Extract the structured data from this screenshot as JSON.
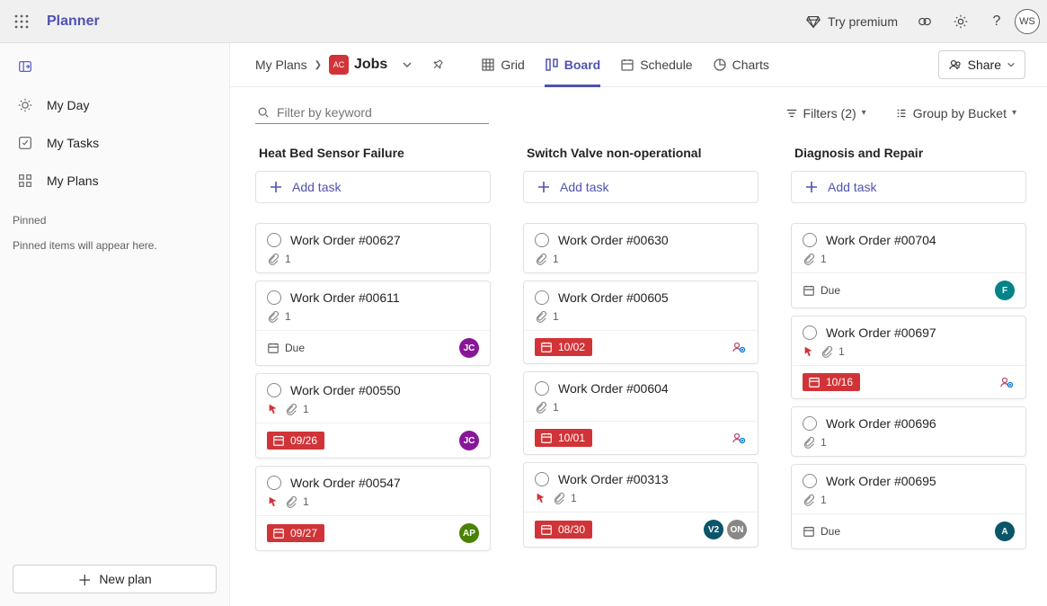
{
  "titlebar": {
    "brand": "Planner",
    "try_premium": "Try premium",
    "avatar_initials": "WS"
  },
  "sidebar": {
    "my_day": "My Day",
    "my_tasks": "My Tasks",
    "my_plans": "My Plans",
    "pinned_header": "Pinned",
    "pinned_empty": "Pinned items will appear here.",
    "new_plan": "New plan"
  },
  "plan_header": {
    "breadcrumb_root": "My Plans",
    "plan_badge": "AC",
    "plan_name": "Jobs",
    "views": {
      "grid": "Grid",
      "board": "Board",
      "schedule": "Schedule",
      "charts": "Charts"
    },
    "share": "Share"
  },
  "toolbar": {
    "filter_placeholder": "Filter by keyword",
    "filters_label": "Filters (2)",
    "group_label": "Group by Bucket"
  },
  "buckets": [
    {
      "title": "Heat Bed Sensor Failure",
      "add_label": "Add task",
      "groups": [
        {
          "rows": [
            {
              "title": "Work Order #00627",
              "attach": "1"
            }
          ]
        },
        {
          "rows": [
            {
              "title": "Work Order #00611",
              "attach": "1"
            }
          ],
          "footer": {
            "type": "plain",
            "text": "Due",
            "avatars": [
              {
                "kind": "purple",
                "text": "JC"
              }
            ]
          }
        },
        {
          "rows": [
            {
              "title": "Work Order #00550",
              "urgent": true,
              "attach": "1"
            }
          ],
          "footer": {
            "type": "red",
            "text": "09/26",
            "avatars": [
              {
                "kind": "purple",
                "text": "JC"
              }
            ]
          }
        },
        {
          "rows": [
            {
              "title": "Work Order #00547",
              "urgent": true,
              "attach": "1"
            }
          ],
          "footer": {
            "type": "red",
            "text": "09/27",
            "avatars": [
              {
                "kind": "dgreen",
                "text": "AP"
              }
            ]
          }
        }
      ]
    },
    {
      "title": "Switch Valve non-operational",
      "add_label": "Add task",
      "groups": [
        {
          "rows": [
            {
              "title": "Work Order #00630",
              "attach": "1"
            }
          ]
        },
        {
          "rows": [
            {
              "title": "Work Order #00605",
              "attach": "1"
            }
          ],
          "footer": {
            "type": "red",
            "text": "10/02",
            "assign_icon": true
          }
        },
        {
          "rows": [
            {
              "title": "Work Order #00604",
              "attach": "1"
            }
          ],
          "footer": {
            "type": "red",
            "text": "10/01",
            "assign_icon": true
          }
        },
        {
          "rows": [
            {
              "title": "Work Order #00313",
              "urgent": true,
              "attach": "1"
            }
          ],
          "footer": {
            "type": "red",
            "text": "08/30",
            "avatars": [
              {
                "kind": "navy",
                "text": "V2"
              },
              {
                "kind": "gray",
                "text": "ON"
              }
            ]
          }
        }
      ]
    },
    {
      "title": "Diagnosis and Repair",
      "add_label": "Add task",
      "groups": [
        {
          "rows": [
            {
              "title": "Work Order #00704",
              "attach": "1"
            }
          ],
          "footer": {
            "type": "plain",
            "text": "Due",
            "avatars": [
              {
                "kind": "teal",
                "text": "F"
              }
            ]
          }
        },
        {
          "rows": [
            {
              "title": "Work Order #00697",
              "urgent": true,
              "attach": "1"
            }
          ],
          "footer": {
            "type": "red",
            "text": "10/16",
            "assign_icon": true
          }
        },
        {
          "rows": [
            {
              "title": "Work Order #00696",
              "attach": "1"
            }
          ]
        },
        {
          "rows": [
            {
              "title": "Work Order #00695",
              "attach": "1"
            }
          ],
          "footer": {
            "type": "plain",
            "text": "Due",
            "avatars": [
              {
                "kind": "navy",
                "text": "A"
              }
            ]
          }
        }
      ]
    }
  ]
}
